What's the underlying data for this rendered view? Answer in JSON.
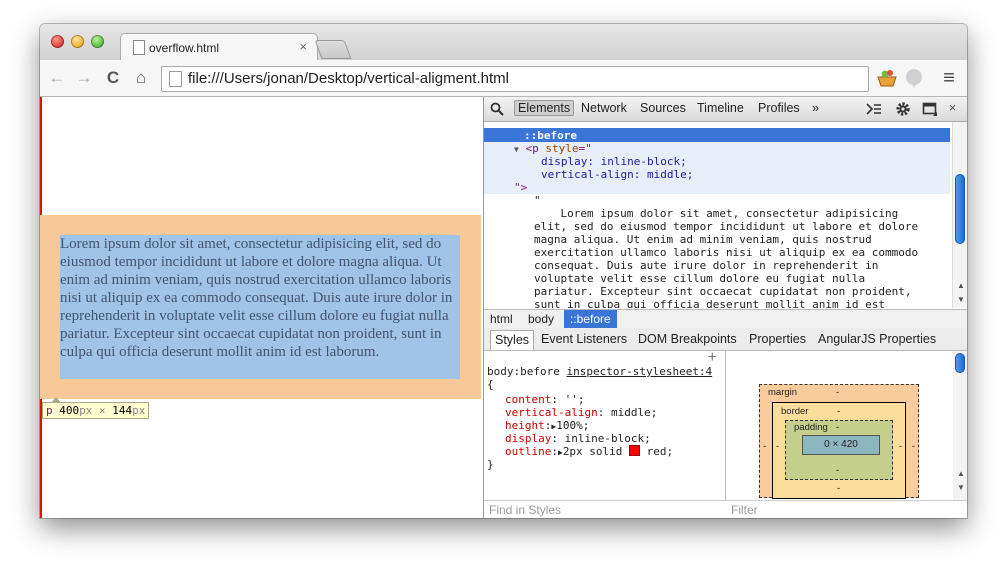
{
  "browser": {
    "tab_title": "overflow.html",
    "tab_close": "×",
    "url": "file:///Users/jonan/Desktop/vertical-aligment.html",
    "back": "←",
    "forward": "→",
    "reload": "C",
    "home": "⌂",
    "menu": "≡"
  },
  "page": {
    "paragraph": "Lorem ipsum dolor sit amet, consectetur adipisicing elit, sed do eiusmod tempor incididunt ut labore et dolore magna aliqua. Ut enim ad minim veniam, quis nostrud exercitation ullamco laboris nisi ut aliquip ex ea commodo consequat. Duis aute irure dolor in reprehenderit in voluptate velit esse cillum dolore eu fugiat nulla pariatur. Excepteur sint occaecat cupidatat non proident, sunt in culpa qui officia deserunt mollit anim id est laborum.",
    "tooltip": {
      "tag": "p",
      "width": "400",
      "height": "144",
      "unit": "px",
      "times": "×"
    }
  },
  "devtools": {
    "search_icon": "search-icon",
    "tabs": [
      "Elements",
      "Network",
      "Sources",
      "Timeline",
      "Profiles"
    ],
    "more": "»",
    "elements": {
      "before": "::before",
      "tag_open": "<p",
      "attr_style": "style",
      "eq_quote": "=\"",
      "decl1": "display: inline-block;",
      "decl2": "vertical-align: middle;",
      "close": "\">",
      "quote": "\"",
      "text": [
        "    Lorem ipsum dolor sit amet, consectetur adipisicing",
        "elit, sed do eiusmod tempor incididunt ut labore et dolore",
        "magna aliqua. Ut enim ad minim veniam, quis nostrud",
        "exercitation ullamco laboris nisi ut aliquip ex ea commodo",
        "consequat. Duis aute irure dolor in reprehenderit in",
        "voluptate velit esse cillum dolore eu fugiat nulla",
        "pariatur. Excepteur sint occaecat cupidatat non proident,",
        "sunt in culpa qui officia deserunt mollit anim id est"
      ]
    },
    "breadcrumbs": [
      "html",
      "body",
      "::before"
    ],
    "subtabs": [
      "Styles",
      "Event Listeners",
      "DOM Breakpoints",
      "Properties",
      "AngularJS Properties"
    ],
    "styles": {
      "plus": "+",
      "selector": "body:before",
      "source": "inspector-stylesheet:4",
      "open_brace": "{",
      "close_brace": "}",
      "rules": [
        {
          "prop": "content",
          "value": "'';"
        },
        {
          "prop": "vertical-align",
          "value": "middle;"
        },
        {
          "prop": "height",
          "value": "100%;"
        },
        {
          "prop": "display",
          "value": "inline-block;"
        },
        {
          "prop": "outline",
          "value": "2px solid  red;"
        }
      ],
      "outline_color": "#ff0000"
    },
    "boxmodel": {
      "margin_label": "margin",
      "border_label": "border",
      "padding_label": "padding",
      "dash": "-",
      "content": "0 × 420"
    },
    "find_styles": "Find in Styles",
    "filter": "Filter"
  }
}
